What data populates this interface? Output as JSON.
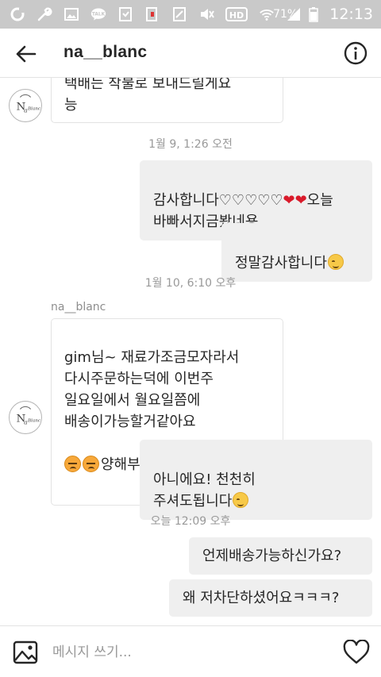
{
  "status_bar": {
    "battery_percent": "71%",
    "time": "12:13",
    "hd_label": "HD",
    "talk_label": "TALK"
  },
  "header": {
    "title": "na__blanc"
  },
  "avatar": {
    "label": "NaBlanc"
  },
  "messages": [
    {
      "direction": "incoming",
      "text": "택배는 착불로 보내드릴게요\n능"
    },
    {
      "timestamp": "1월 9, 1:26 오전"
    },
    {
      "direction": "outgoing",
      "text_prefix": "감사합니다♡♡♡♡♡",
      "text_suffix": "오늘\n바빠서지금봤네용"
    },
    {
      "direction": "outgoing",
      "text": "정말감사합니다"
    },
    {
      "timestamp": "1월 10, 6:10 오후"
    },
    {
      "sender": "na__blanc"
    },
    {
      "direction": "incoming",
      "text": "gim님~ 재료가조금모자라서\n다시주문하는덕에 이번주\n일요일에서 월요일쯤에\n배송이가능할거같아요",
      "last_line": "양해부탁드릴게요~~"
    },
    {
      "direction": "outgoing",
      "text": "아니에요! 천천히\n주셔도됩니다"
    },
    {
      "timestamp": "오늘 12:09 오후"
    },
    {
      "direction": "outgoing",
      "text": "언제배송가능하신가요?"
    },
    {
      "direction": "outgoing",
      "text": "왜 저차단하셨어요ㅋㅋㅋ?"
    }
  ],
  "composer": {
    "placeholder": "메시지 쓰기..."
  },
  "icons": {
    "back": "arrow-left-icon",
    "info": "info-icon",
    "gallery": "image-icon",
    "like": "heart-icon"
  },
  "colors": {
    "status_bar_bg": "#c9c9c9",
    "outgoing_bubble": "#efefef",
    "incoming_border": "#e3e3e3",
    "timestamp_text": "#999999"
  }
}
